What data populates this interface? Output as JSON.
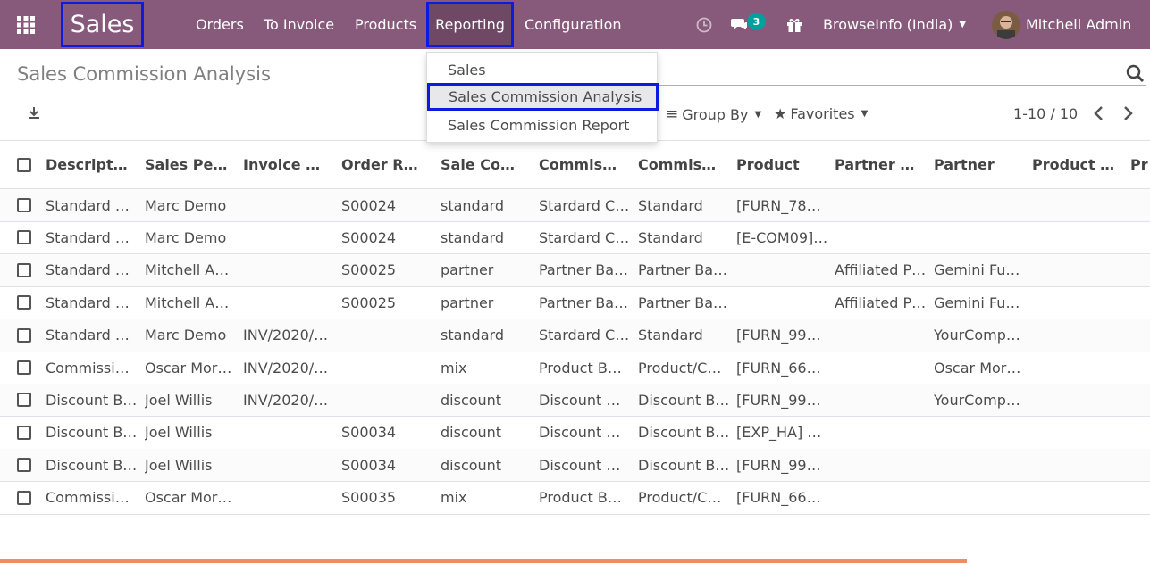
{
  "navbar": {
    "brand": "Sales",
    "menus": [
      "Orders",
      "To Invoice",
      "Products",
      "Reporting",
      "Configuration"
    ],
    "messages_count": "3",
    "company": "BrowseInfo (India)",
    "user": "Mitchell Admin"
  },
  "reporting_menu": {
    "items": [
      "Sales",
      "Sales Commission Analysis",
      "Sales Commission Report"
    ]
  },
  "page": {
    "title": "Sales Commission Analysis",
    "group_by": "Group By",
    "favorites": "Favorites",
    "pager": "1-10 / 10"
  },
  "table": {
    "headers": [
      "Descript…",
      "Sales Pe…",
      "Invoice …",
      "Order R…",
      "Sale Co…",
      "Commis…",
      "Commis…",
      "Product",
      "Partner …",
      "Partner",
      "Product …",
      "Pr"
    ],
    "rows": [
      [
        "Standard …",
        "Marc Demo",
        "",
        "S00024",
        "standard",
        "Stardard C…",
        "Standard",
        "[FURN_78…",
        "",
        "",
        ""
      ],
      [
        "Standard …",
        "Marc Demo",
        "",
        "S00024",
        "standard",
        "Stardard C…",
        "Standard",
        "[E-COM09]…",
        "",
        "",
        ""
      ],
      [
        "Standard …",
        "Mitchell A…",
        "",
        "S00025",
        "partner",
        "Partner Ba…",
        "Partner Ba…",
        "",
        "Affiliated P…",
        "Gemini Fu…",
        ""
      ],
      [
        "Standard …",
        "Mitchell A…",
        "",
        "S00025",
        "partner",
        "Partner Ba…",
        "Partner Ba…",
        "",
        "Affiliated P…",
        "Gemini Fu…",
        ""
      ],
      [
        "Standard …",
        "Marc Demo",
        "INV/2020/…",
        "",
        "standard",
        "Stardard C…",
        "Standard",
        "[FURN_99…",
        "",
        "YourComp…",
        ""
      ],
      [
        "Commissi…",
        "Oscar Mor…",
        "INV/2020/…",
        "",
        "mix",
        "Product B…",
        "Product/C…",
        "[FURN_66…",
        "",
        "Oscar Mor…",
        ""
      ],
      [
        "Discount B…",
        "Joel Willis",
        "INV/2020/…",
        "",
        "discount",
        "Discount …",
        "Discount B…",
        "[FURN_99…",
        "",
        "YourComp…",
        ""
      ],
      [
        "Discount B…",
        "Joel Willis",
        "",
        "S00034",
        "discount",
        "Discount …",
        "Discount B…",
        "[EXP_HA] …",
        "",
        "",
        ""
      ],
      [
        "Discount B…",
        "Joel Willis",
        "",
        "S00034",
        "discount",
        "Discount …",
        "Discount B…",
        "[FURN_99…",
        "",
        "",
        ""
      ],
      [
        "Commissi…",
        "Oscar Mor…",
        "",
        "S00035",
        "mix",
        "Product B…",
        "Product/C…",
        "[FURN_66…",
        "",
        "",
        ""
      ]
    ]
  }
}
